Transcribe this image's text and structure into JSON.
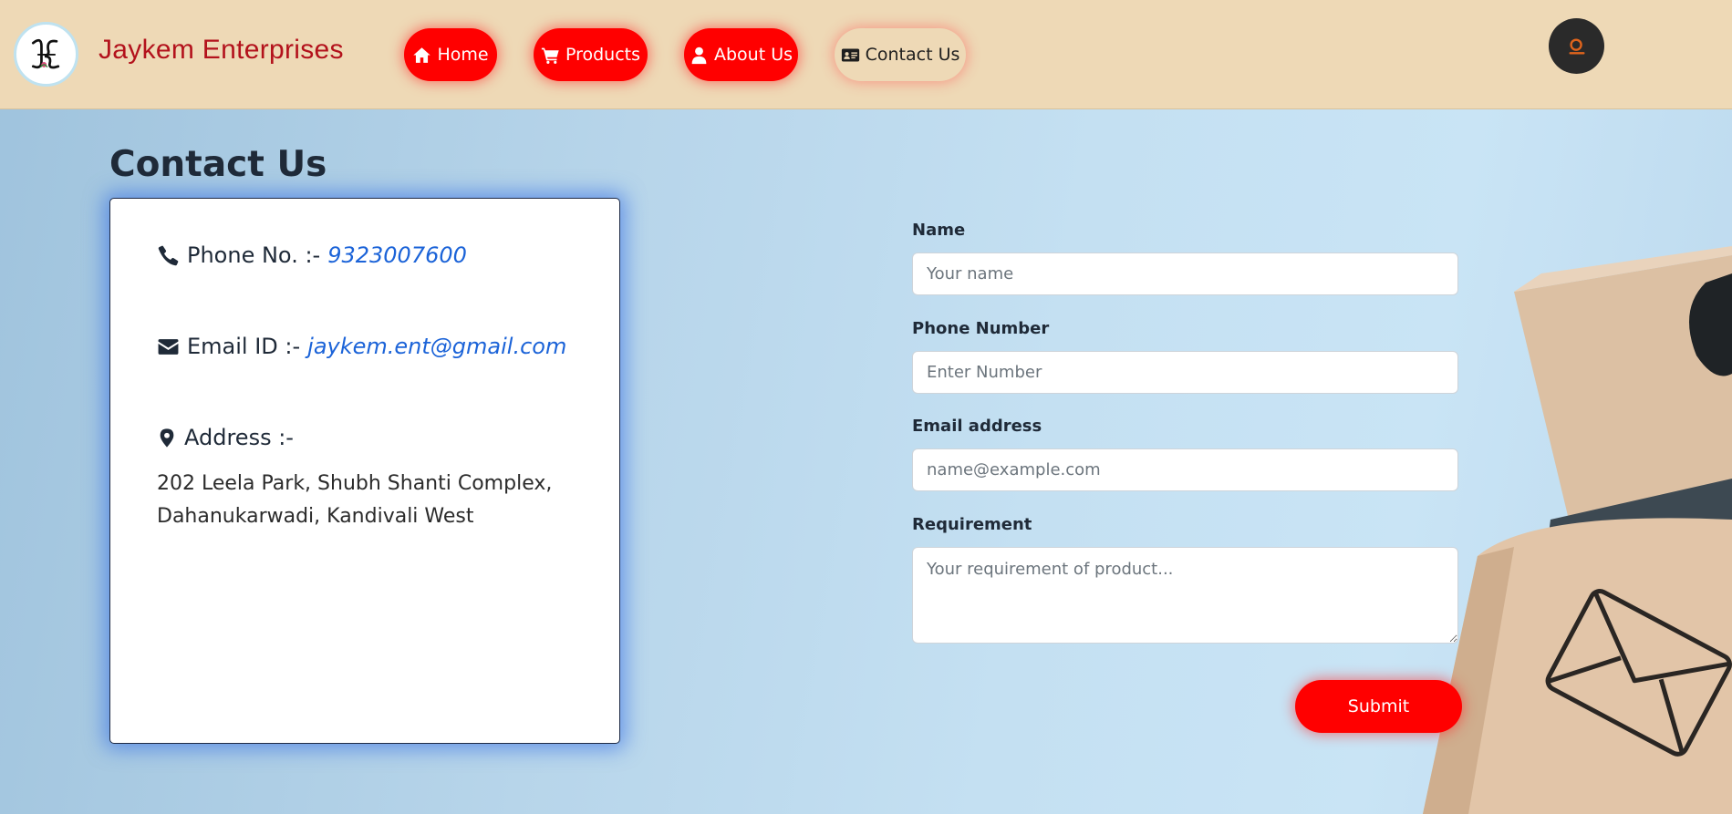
{
  "header": {
    "brand": "Jaykem Enterprises",
    "logo_icon": "je-monogram-logo",
    "nav": [
      {
        "label": "Home",
        "icon": "home-icon"
      },
      {
        "label": "Products",
        "icon": "cart-icon"
      },
      {
        "label": "About Us",
        "icon": "user-icon"
      },
      {
        "label": "Contact Us",
        "icon": "id-card-icon",
        "active": true
      }
    ],
    "search_icon": "search-icon"
  },
  "main": {
    "title": "Contact Us",
    "contact_card": {
      "phone_label": "Phone No. :-",
      "phone_value": "9323007600",
      "email_label": "Email ID :-",
      "email_value": "jaykem.ent@gmail.com",
      "address_label": "Address :-",
      "address_line1": "202 Leela Park, Shubh Shanti Complex,",
      "address_line2": "Dahanukarwadi, Kandivali West"
    },
    "form": {
      "name_label": "Name",
      "name_placeholder": "Your name",
      "phone_label": "Phone Number",
      "phone_placeholder": "Enter Number",
      "email_label": "Email address",
      "email_placeholder": "name@example.com",
      "requirement_label": "Requirement",
      "requirement_placeholder": "Your requirement of product...",
      "submit_label": "Submit"
    }
  },
  "colors": {
    "navbar_bg": "#eed9b6",
    "brand_text": "#b3121c",
    "accent_red": "#ff0000",
    "link_blue": "#1b63d8",
    "card_glow": "#2864e6",
    "search_button_bg": "#2a2a2a",
    "search_icon_color": "#e0641c"
  }
}
